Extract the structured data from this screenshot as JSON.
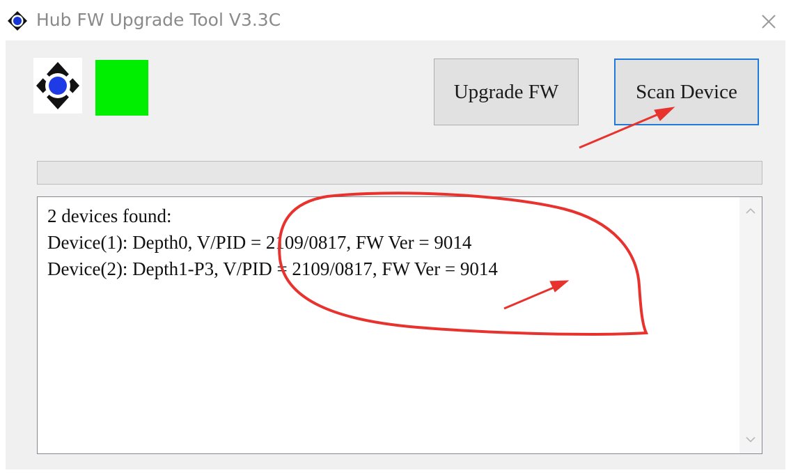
{
  "window": {
    "title": "Hub FW Upgrade Tool V3.3C",
    "close_icon": "close-icon",
    "app_icon": "hub-logo-icon"
  },
  "toolbar": {
    "upgrade_label": "Upgrade FW",
    "scan_label": "Scan Device"
  },
  "status": {
    "indicator_color": "#00ee00",
    "progress_fraction": 0
  },
  "log": {
    "lines": [
      "2 devices found:",
      "Device(1): Depth0, V/PID = 2109/0817, FW Ver = 9014",
      "Device(2): Depth1-P3, V/PID = 2109/0817, FW Ver = 9014"
    ]
  },
  "colors": {
    "accent_focus": "#1e7ad6",
    "annotation_red": "#e8322e"
  }
}
